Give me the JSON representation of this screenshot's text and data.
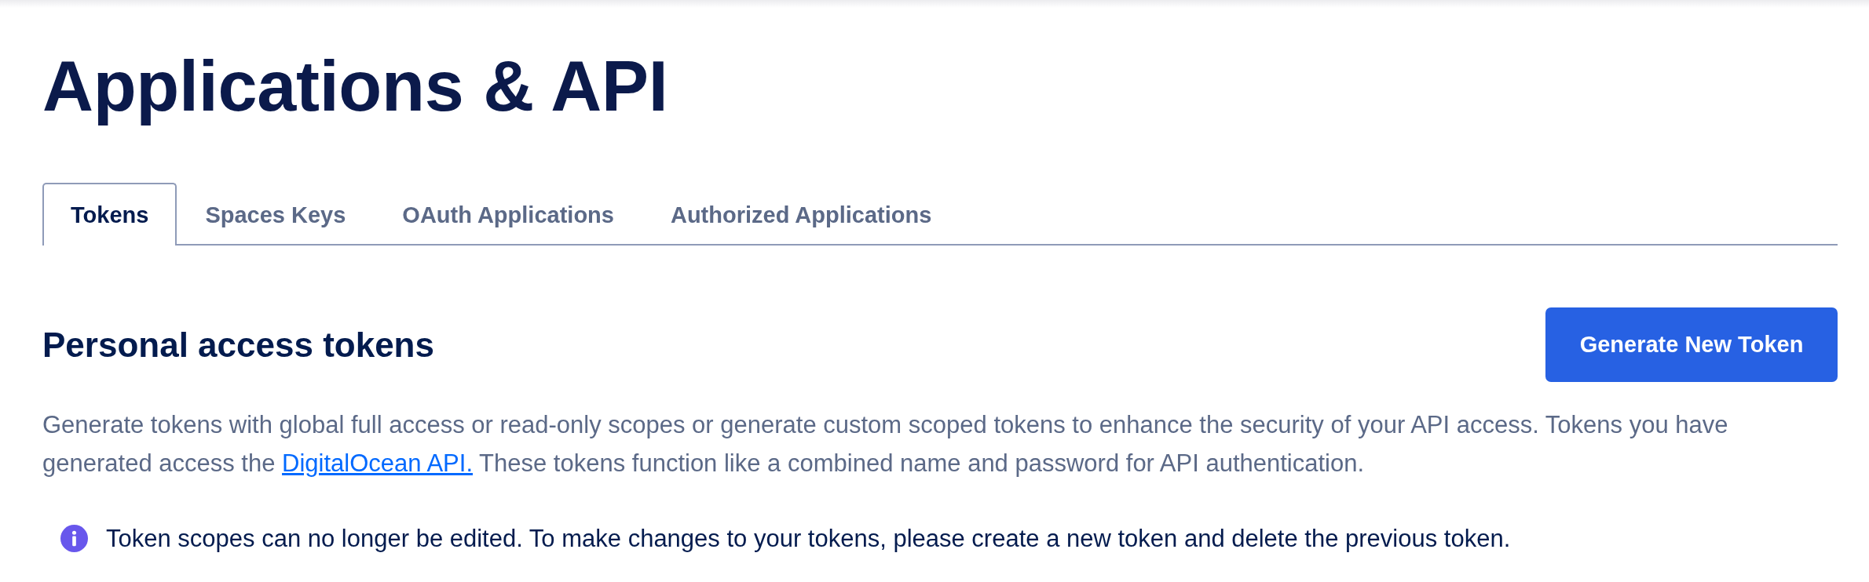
{
  "page": {
    "title": "Applications & API"
  },
  "tabs": [
    {
      "label": "Tokens",
      "selected": true
    },
    {
      "label": "Spaces Keys",
      "selected": false
    },
    {
      "label": "OAuth Applications",
      "selected": false
    },
    {
      "label": "Authorized Applications",
      "selected": false
    }
  ],
  "section": {
    "heading": "Personal access tokens",
    "button": "Generate New Token",
    "description": {
      "text_before": "Generate tokens with global full access or read-only scopes or generate custom scoped tokens to enhance the security of your API access. Tokens you have generated access the ",
      "link": "DigitalOcean API.",
      "text_after": " These tokens function like a combined name and password for API authentication."
    }
  },
  "notice": {
    "text": "Token scopes can no longer be edited. To make changes to your tokens, please create a new token and delete the previous token."
  }
}
